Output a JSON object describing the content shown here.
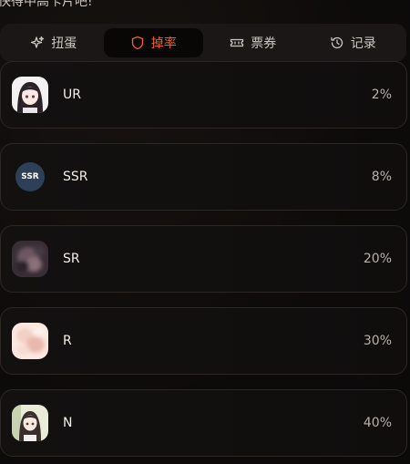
{
  "header": {
    "partial_text": "快得中高卡片吧!"
  },
  "tabs": [
    {
      "label": "扭蛋",
      "icon": "sparkle-icon",
      "active": false
    },
    {
      "label": "掉率",
      "icon": "shield-icon",
      "active": true
    },
    {
      "label": "票券",
      "icon": "ticket-icon",
      "active": false
    },
    {
      "label": "记录",
      "icon": "history-icon",
      "active": false
    }
  ],
  "rates": [
    {
      "rarity": "UR",
      "rate": "2%",
      "avatar": "anime-girl-portrait"
    },
    {
      "rarity": "SSR",
      "rate": "8%",
      "avatar": "ssr-badge",
      "badge_text": "SSR"
    },
    {
      "rarity": "SR",
      "rate": "20%",
      "avatar": "blurred-character-portrait"
    },
    {
      "rarity": "R",
      "rate": "30%",
      "avatar": "blurred-pastel-portrait"
    },
    {
      "rarity": "N",
      "rate": "40%",
      "avatar": "anime-girl-portrait"
    }
  ],
  "colors": {
    "accent": "#e8622a",
    "background": "#0d0b0a",
    "card_border": "#2c2724",
    "ssr_badge": "#2e4057"
  }
}
